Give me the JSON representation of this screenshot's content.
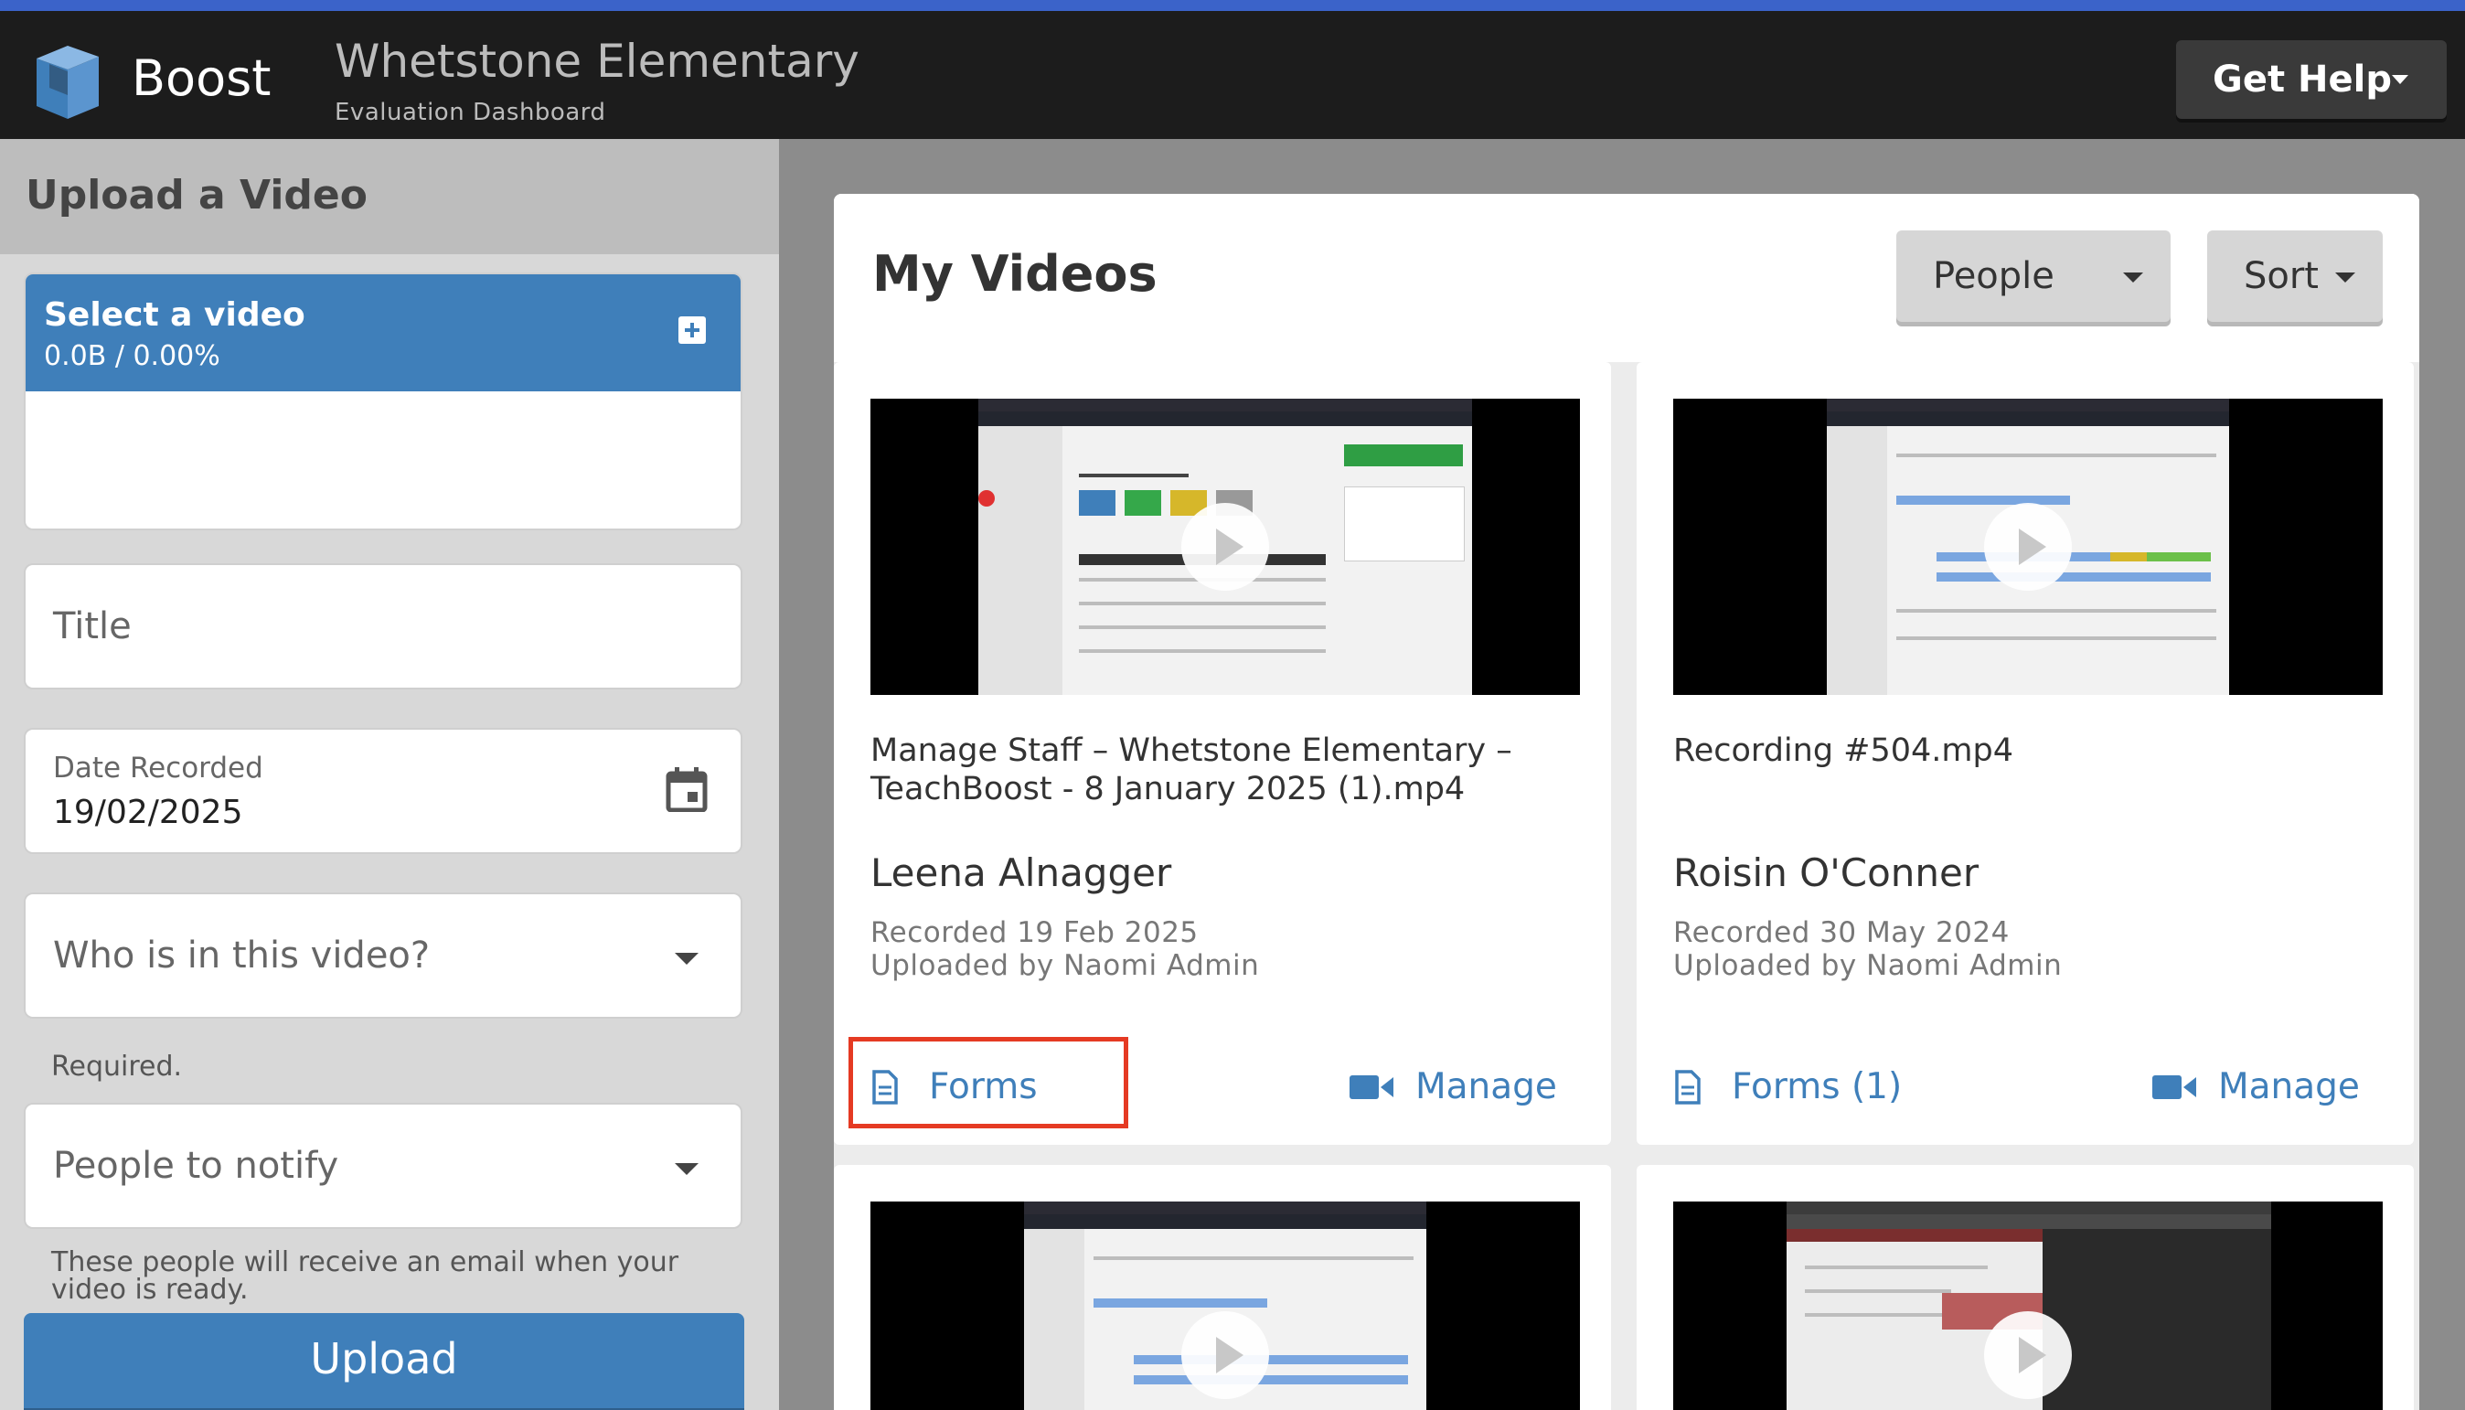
{
  "header": {
    "brand": "Boost",
    "school": "Whetstone Elementary",
    "subtitle": "Evaluation Dashboard",
    "help_label": "Get Help"
  },
  "sidebar": {
    "title": "Upload a Video",
    "select_label": "Select a video",
    "select_progress": "0.0B / 0.00%",
    "title_placeholder": "Title",
    "date_label": "Date Recorded",
    "date_value": "19/02/2025",
    "who_placeholder": "Who is in this video?",
    "required_text": "Required.",
    "notify_placeholder": "People to notify",
    "notify_help": "These people will receive an email when your video is ready.",
    "upload_label": "Upload"
  },
  "main": {
    "title": "My Videos",
    "people_label": "People",
    "sort_label": "Sort",
    "videos": [
      {
        "title": "Manage Staff – Whetstone Elementary – TeachBoost - 8 January 2025 (1).mp4",
        "person": "Leena Alnagger",
        "recorded": "Recorded 19 Feb 2025",
        "uploaded": "Uploaded by Naomi Admin",
        "forms_label": "Forms",
        "manage_label": "Manage"
      },
      {
        "title": "Recording #504.mp4",
        "person": "Roisin O'Conner",
        "recorded": "Recorded 30 May 2024",
        "uploaded": "Uploaded by Naomi Admin",
        "forms_label": "Forms (1)",
        "manage_label": "Manage"
      }
    ]
  },
  "colors": {
    "accent": "#3f7fba",
    "topbar": "#1c1c1c",
    "highlight": "#e53a23"
  },
  "icons": [
    "logo-icon",
    "plus-icon",
    "calendar-icon",
    "chevron-down-icon",
    "document-icon",
    "video-camera-icon",
    "play-icon"
  ]
}
